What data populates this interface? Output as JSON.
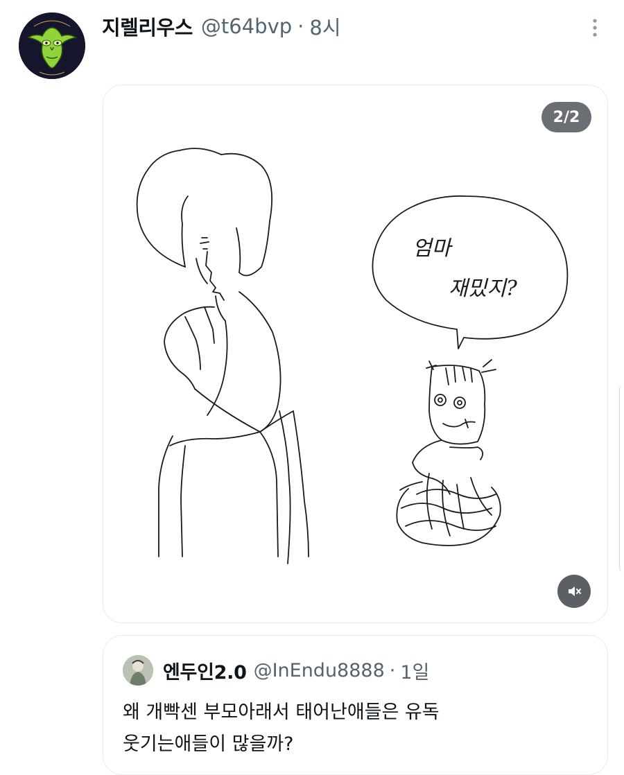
{
  "tweet": {
    "display_name": "지렐리우스",
    "handle": "@t64bvp",
    "separator": "·",
    "time": "8시",
    "avatar_icon": "goblin-face-avatar",
    "more_icon": "vertical-dots-icon"
  },
  "media": {
    "counter": "2/2",
    "speech_line1": "엄마",
    "speech_line2": "재밌지?",
    "mute_icon": "speaker-mute-icon"
  },
  "quoted": {
    "display_name": "엔두인2.0",
    "handle": "@InEndu8888",
    "separator": "·",
    "time": "1일",
    "text_line1": "왜 개빡센 부모아래서 태어난애들은 유독",
    "text_line2": "웃기는애들이 많을까?"
  },
  "colors": {
    "text": "#0f1419",
    "secondary": "#536471",
    "border": "#e6ecf0",
    "badge_bg": "#6b6f73"
  }
}
